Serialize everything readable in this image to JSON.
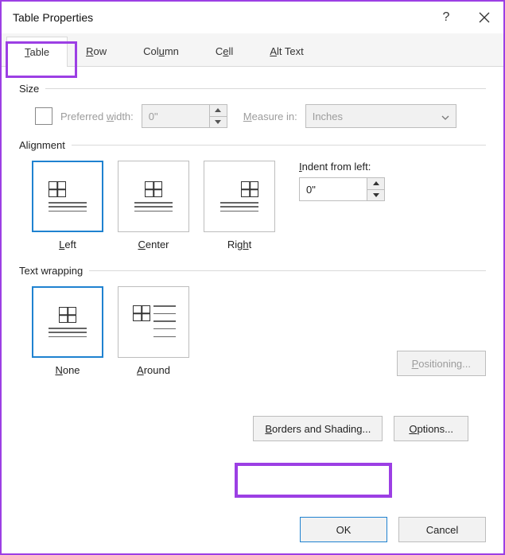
{
  "title": "Table Properties",
  "help": "?",
  "tabs": {
    "table": "Table",
    "row": "Row",
    "column": "Column",
    "cell": "Cell",
    "alttext": "Alt Text"
  },
  "groups": {
    "size": "Size",
    "alignment": "Alignment",
    "textwrap": "Text wrapping"
  },
  "size": {
    "preferred_width": "Preferred width:",
    "width_value": "0\"",
    "measure_in": "Measure in:",
    "measure_value": "Inches"
  },
  "alignment": {
    "left": "Left",
    "center": "Center",
    "right": "Right",
    "indent_label": "Indent from left:",
    "indent_value": "0\""
  },
  "wrap": {
    "none": "None",
    "around": "Around"
  },
  "buttons": {
    "positioning": "Positioning...",
    "borders": "Borders and Shading...",
    "options": "Options...",
    "ok": "OK",
    "cancel": "Cancel"
  }
}
